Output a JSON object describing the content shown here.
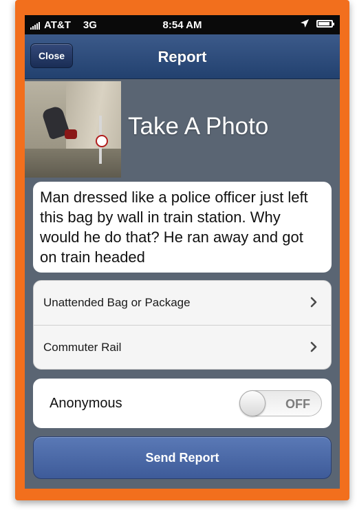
{
  "status_bar": {
    "carrier": "AT&T",
    "network": "3G",
    "time": "8:54 AM"
  },
  "nav": {
    "close_label": "Close",
    "title": "Report"
  },
  "photo": {
    "label": "Take A Photo"
  },
  "description": {
    "text": "Man dressed like a police officer just left this bag by wall in train station. Why would he do that? He ran away and got on train headed"
  },
  "categories": [
    {
      "label": "Unattended Bag or Package"
    },
    {
      "label": "Commuter Rail"
    }
  ],
  "anonymous": {
    "label": "Anonymous",
    "state": "OFF"
  },
  "send_button": {
    "label": "Send Report"
  },
  "colors": {
    "frame": "#f26f1d",
    "nav_bar": "#2d4b7c",
    "background": "#5a6573",
    "send_button": "#4c69a8"
  }
}
